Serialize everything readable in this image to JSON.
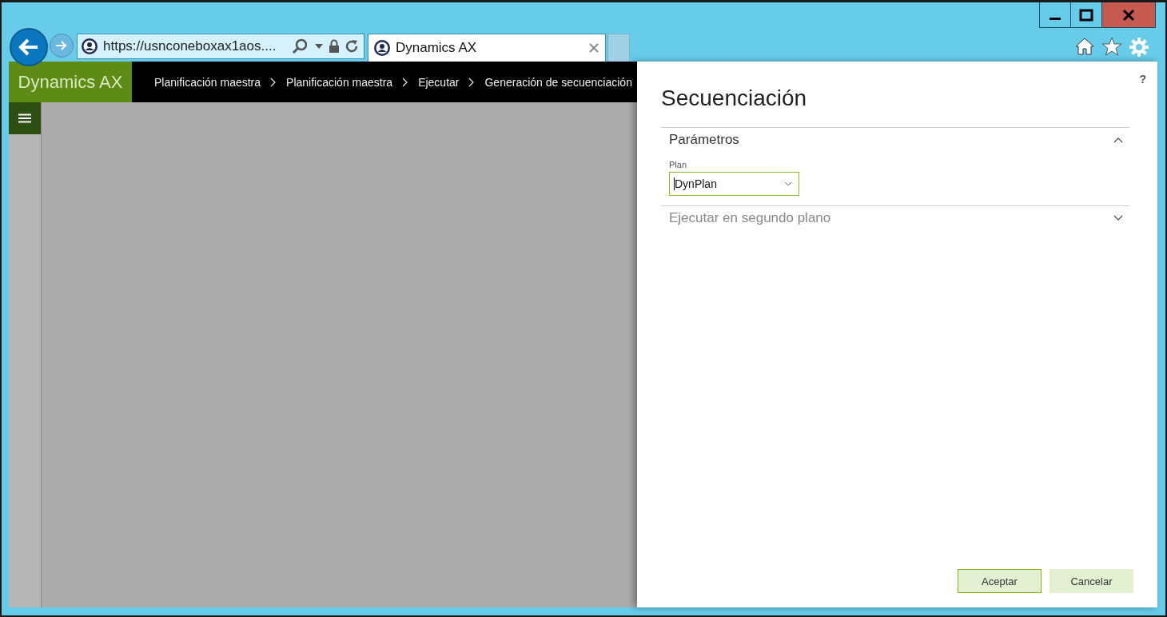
{
  "browser": {
    "address": "https://usnconeboxax1aos....",
    "tabs": [
      {
        "title": "Dynamics AX",
        "selected": true
      }
    ]
  },
  "app": {
    "brand": "Dynamics AX",
    "breadcrumb": [
      "Planificación maestra",
      "Planificación maestra",
      "Ejecutar",
      "Generación de secuenciación"
    ]
  },
  "dialog": {
    "help": "?",
    "title": "Secuenciación",
    "sections": [
      {
        "title": "Parámetros",
        "expanded": true,
        "fields": [
          {
            "label": "Plan",
            "value": "DynPlan"
          }
        ]
      },
      {
        "title": "Ejecutar en segundo plano",
        "expanded": false
      }
    ],
    "buttons": [
      {
        "label": "Aceptar",
        "default": true
      },
      {
        "label": "Cancelar",
        "default": false
      }
    ]
  }
}
